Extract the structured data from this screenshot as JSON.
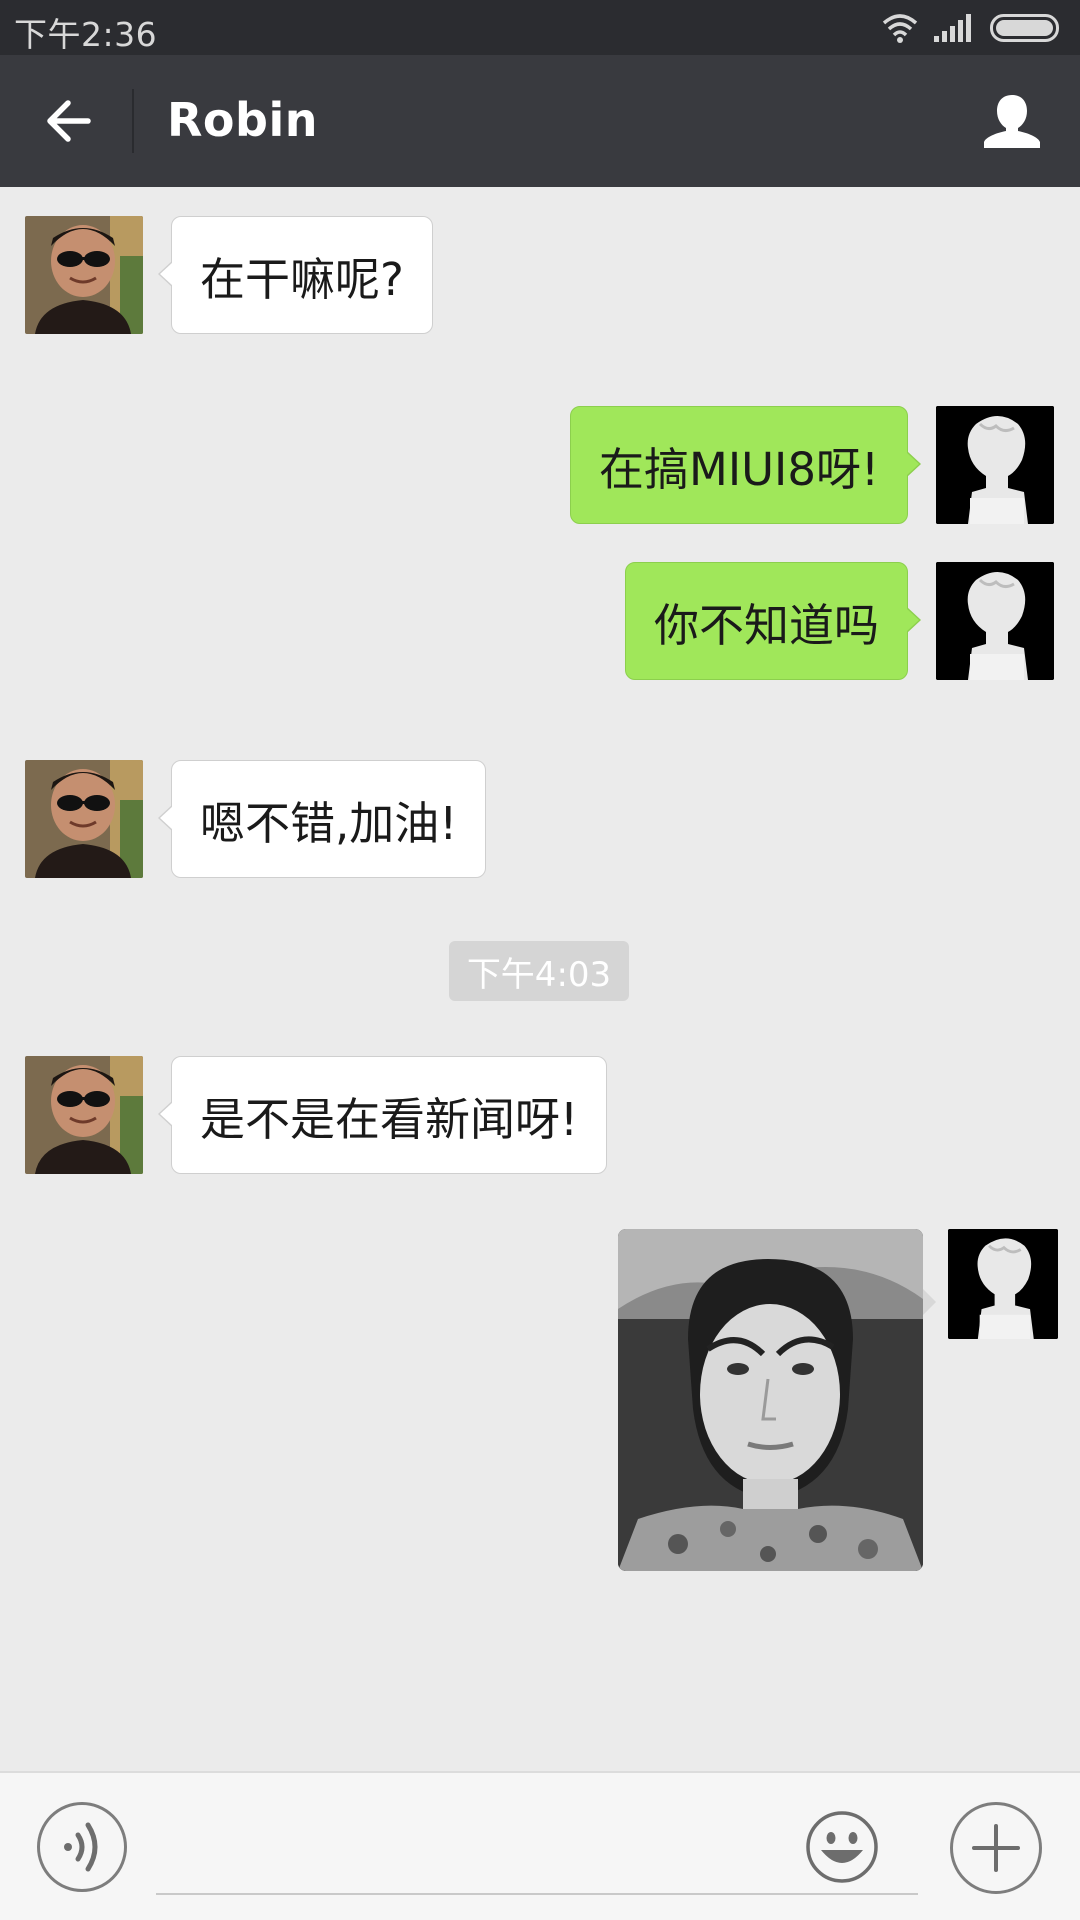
{
  "status_bar": {
    "time": "下午2:36"
  },
  "header": {
    "title": "Robin"
  },
  "messages": [
    {
      "direction": "in",
      "text": "在干嘛呢?"
    },
    {
      "direction": "out",
      "text": "在搞MIUI8呀!"
    },
    {
      "direction": "out",
      "text": "你不知道吗"
    },
    {
      "direction": "in",
      "text": "嗯不错,加油!"
    },
    {
      "direction": "in",
      "text": "是不是在看新闻呀!"
    },
    {
      "direction": "out",
      "type": "image"
    }
  ],
  "timestamp": "下午4:03",
  "colors": {
    "outgoing_bubble": "#a0e75a",
    "incoming_bubble": "#ffffff",
    "header_bg": "#393a3f",
    "chat_bg": "#ebebeb"
  },
  "icons": {
    "back": "arrow-left-icon",
    "profile": "person-icon",
    "voice": "voice-icon",
    "emoji": "smiley-icon",
    "more": "plus-icon"
  }
}
